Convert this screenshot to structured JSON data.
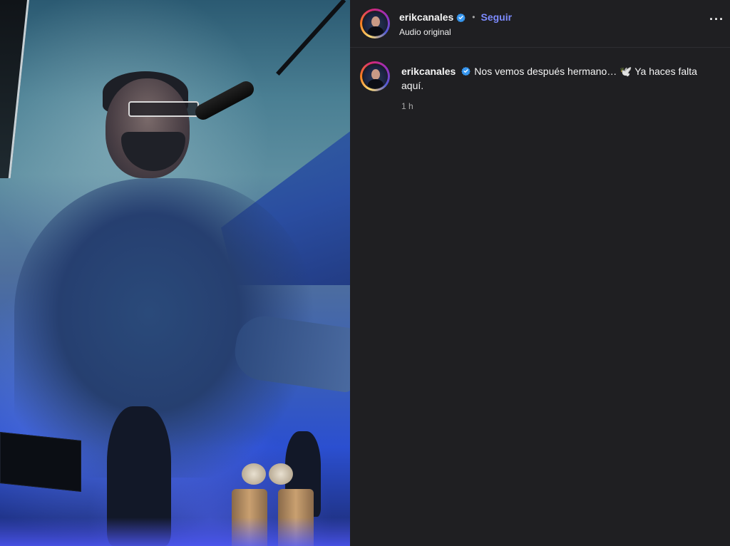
{
  "post": {
    "author": {
      "username": "erikcanales",
      "verified": true,
      "follow_label": "Seguir",
      "separator": "•",
      "subtitle": "Audio original"
    },
    "more_label": "···",
    "caption": {
      "username": "erikcanales",
      "text_line": "Nos vemos después hermano… 🕊️ Ya haces falta aquí.",
      "timestamp": "1 h"
    }
  },
  "colors": {
    "panel_bg": "#1f1f22",
    "follow_blue": "#7d8bff",
    "verified_blue": "#3797f0",
    "muted_text": "#a8a8a8"
  },
  "icons": {
    "verified": "verified-badge-icon",
    "more": "more-options-icon"
  }
}
